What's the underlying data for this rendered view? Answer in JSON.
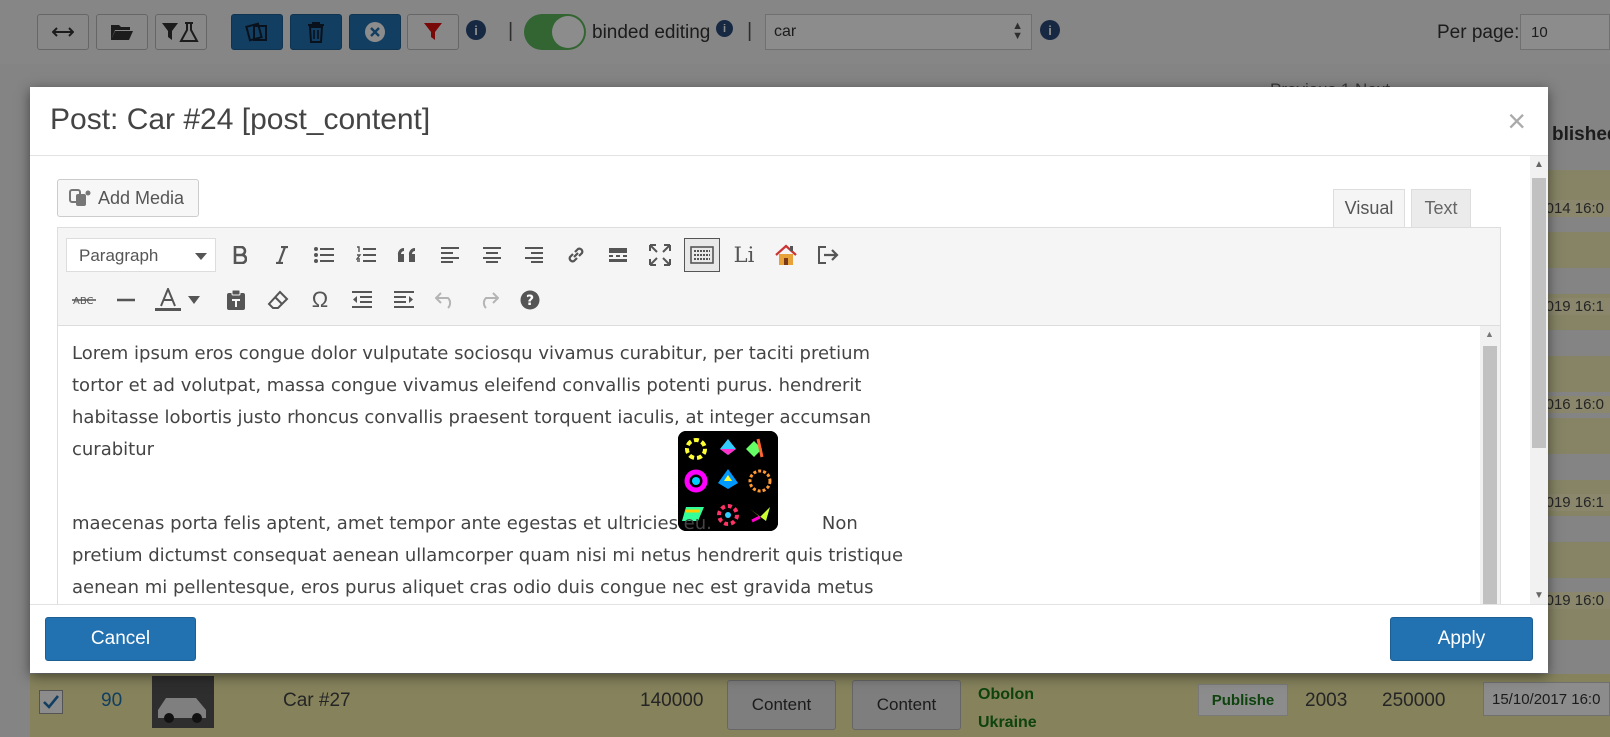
{
  "background": {
    "toolbar": {
      "binded_label": "binded editing",
      "separator": "|",
      "search_value": "car",
      "per_page_label": "Per page:",
      "per_page_value": "10"
    },
    "pagination_fragment": "Previous 1 Next",
    "right_header_fragment": "blished",
    "dates": [
      "014 16:0",
      "019 16:1",
      "016 16:0",
      "019 16:1",
      "019 16:0"
    ],
    "row": {
      "id": "90",
      "title": "Car #27",
      "price": "140000",
      "content_btn_1": "Content",
      "content_btn_2": "Content",
      "location_1": "Obolon",
      "location_2": "Ukraine",
      "status": "Publishe",
      "year": "2003",
      "mileage": "250000",
      "date": "15/10/2017 16:0"
    }
  },
  "modal": {
    "title": "Post: Car #24 [post_content]",
    "close_glyph": "×",
    "add_media_label": "Add Media",
    "tabs": [
      {
        "label": "Visual",
        "active": true
      },
      {
        "label": "Text",
        "active": false
      }
    ],
    "format_select": "Paragraph",
    "li_label": "Li",
    "content": {
      "paragraph_1": "Lorem ipsum eros congue dolor vulputate sociosqu vivamus curabitur, per taciti pretium tortor et ad volutpat, massa congue vivamus eleifend convallis potenti purus. hendrerit habitasse lobortis justo rhoncus convallis praesent torquent iaculis, at integer accumsan curabitur",
      "paragraph_2_before_image": "maecenas porta felis aptent, amet tempor ante egestas et ultricies eu.",
      "paragraph_2_after_image": "Non pretium dictumst consequat aenean ullamcorper quam nisi mi netus hendrerit quis tristique aenean mi pellentesque, eros purus aliquet cras odio duis congue nec est gravida metus dictumst"
    },
    "cancel_label": "Cancel",
    "apply_label": "Apply"
  },
  "colors": {
    "primary": "#2271b1",
    "toggle_on": "#5cb85c",
    "row_highlight": "#f5f1b8",
    "link_blue": "#2271b1",
    "status_green": "#1a7a1a"
  },
  "icons": {
    "row1": [
      "bold-icon",
      "italic-icon",
      "bullet-list-icon",
      "numbered-list-icon",
      "blockquote-icon",
      "align-left-icon",
      "align-center-icon",
      "align-right-icon",
      "link-icon",
      "read-more-icon",
      "fullscreen-icon",
      "toolbar-toggle-icon",
      "li-icon",
      "house-icon",
      "exit-icon"
    ],
    "row2": [
      "strikethrough-icon",
      "horizontal-line-icon",
      "text-color-icon",
      "paste-text-icon",
      "clear-formatting-icon",
      "special-char-icon",
      "outdent-icon",
      "indent-icon",
      "undo-icon",
      "redo-icon",
      "help-icon"
    ]
  }
}
